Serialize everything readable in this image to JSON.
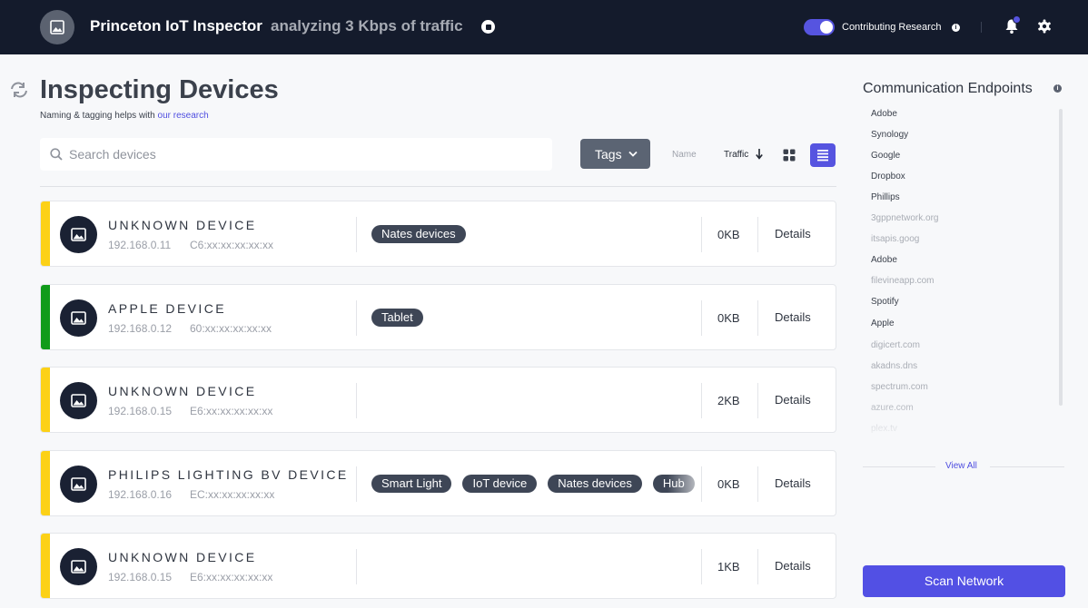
{
  "header": {
    "app_title": "Princeton IoT Inspector",
    "subtitle": "analyzing 3 Kbps of traffic",
    "contributing_label": "Contributing Research",
    "contributing_on": true,
    "info_glyph": "i"
  },
  "page": {
    "title": "Inspecting Devices",
    "subtitle_prefix": "Naming & tagging helps with ",
    "subtitle_link": "our research"
  },
  "toolbar": {
    "search_placeholder": "Search devices",
    "tags_label": "Tags",
    "sort_name_label": "Name",
    "sort_traffic_label": "Traffic",
    "active_view": "list"
  },
  "devices": [
    {
      "name": "UNKNOWN DEVICE",
      "ip": "192.168.0.11",
      "mac": "C6:xx:xx:xx:xx:xx",
      "tags": [
        "Nates devices"
      ],
      "traffic": "0KB",
      "details_label": "Details",
      "status_color": "#fcd117"
    },
    {
      "name": "APPLE DEVICE",
      "ip": "192.168.0.12",
      "mac": "60:xx:xx:xx:xx:xx",
      "tags": [
        "Tablet"
      ],
      "traffic": "0KB",
      "details_label": "Details",
      "status_color": "#109b1a"
    },
    {
      "name": "UNKNOWN DEVICE",
      "ip": "192.168.0.15",
      "mac": "E6:xx:xx:xx:xx:xx",
      "tags": [],
      "traffic": "2KB",
      "details_label": "Details",
      "status_color": "#fcd117"
    },
    {
      "name": "PHILIPS LIGHTING BV DEVICE",
      "ip": "192.168.0.16",
      "mac": "EC:xx:xx:xx:xx:xx",
      "tags": [
        "Smart Light",
        "IoT device",
        "Nates devices",
        "Hub"
      ],
      "traffic": "0KB",
      "details_label": "Details",
      "status_color": "#fcd117"
    },
    {
      "name": "UNKNOWN DEVICE",
      "ip": "192.168.0.15",
      "mac": "E6:xx:xx:xx:xx:xx",
      "tags": [],
      "traffic": "1KB",
      "details_label": "Details",
      "status_color": "#fcd117"
    }
  ],
  "endpoints_panel": {
    "title": "Communication Endpoints",
    "items": [
      {
        "name": "Adobe",
        "color": "#3b414c"
      },
      {
        "name": "Synology",
        "color": "#3b414c"
      },
      {
        "name": "Google",
        "color": "#3b414c"
      },
      {
        "name": "Dropbox",
        "color": "#3b414c"
      },
      {
        "name": "Phillips",
        "color": "#3b414c"
      },
      {
        "name": "3gppnetwork.org",
        "color": "#a9adb5"
      },
      {
        "name": "itsapis.goog",
        "color": "#a9adb5"
      },
      {
        "name": "Adobe",
        "color": "#3b414c"
      },
      {
        "name": "filevineapp.com",
        "color": "#a9adb5"
      },
      {
        "name": "Spotify",
        "color": "#3b414c"
      },
      {
        "name": "Apple",
        "color": "#3b414c"
      },
      {
        "name": "digicert.com",
        "color": "#a9adb5"
      },
      {
        "name": "akadns.dns",
        "color": "#a9adb5"
      },
      {
        "name": "spectrum.com",
        "color": "#a9adb5"
      },
      {
        "name": "azure.com",
        "color": "#a9adb5"
      },
      {
        "name": "plex.tv",
        "color": "#a9adb5"
      }
    ],
    "view_all_label": "View All",
    "scan_label": "Scan Network"
  },
  "icons": [
    "image-icon",
    "stop-icon",
    "info-icon",
    "bell-icon",
    "gear-icon",
    "refresh-icon",
    "search-icon",
    "chevron-down-icon",
    "arrow-down-icon",
    "grid-view-icon",
    "list-view-icon"
  ]
}
